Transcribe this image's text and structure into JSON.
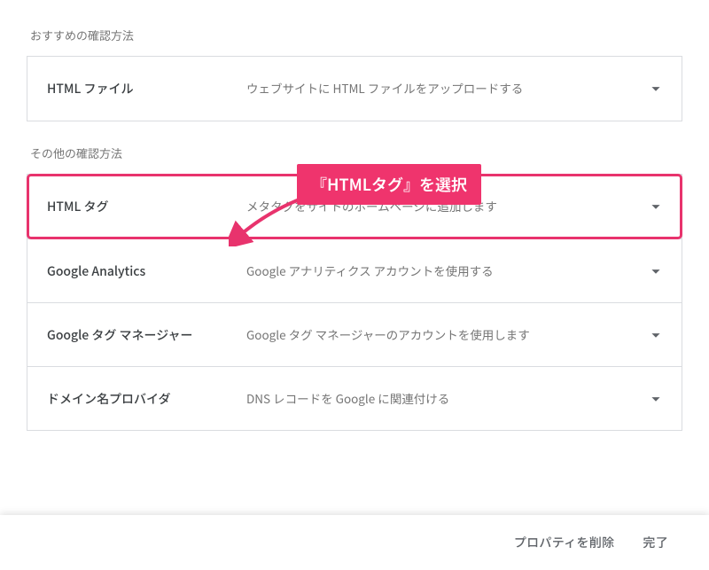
{
  "recommended_label": "おすすめの確認方法",
  "recommended_method": {
    "title": "HTML ファイル",
    "desc": "ウェブサイトに HTML ファイルをアップロードする"
  },
  "other_label": "その他の確認方法",
  "other_methods": [
    {
      "title": "HTML タグ",
      "desc": "メタタグをサイトのホームページに追加します"
    },
    {
      "title": "Google Analytics",
      "desc": "Google アナリティクス アカウントを使用する"
    },
    {
      "title": "Google タグ マネージャー",
      "desc": "Google タグ マネージャーのアカウントを使用します"
    },
    {
      "title": "ドメイン名プロバイダ",
      "desc": "DNS レコードを Google に関連付ける"
    }
  ],
  "callout_text": "『HTMLタグ』を選択",
  "footer": {
    "delete_label": "プロパティを削除",
    "done_label": "完了"
  },
  "colors": {
    "highlight": "#e8336d",
    "callout_bg": "#ef346d"
  }
}
